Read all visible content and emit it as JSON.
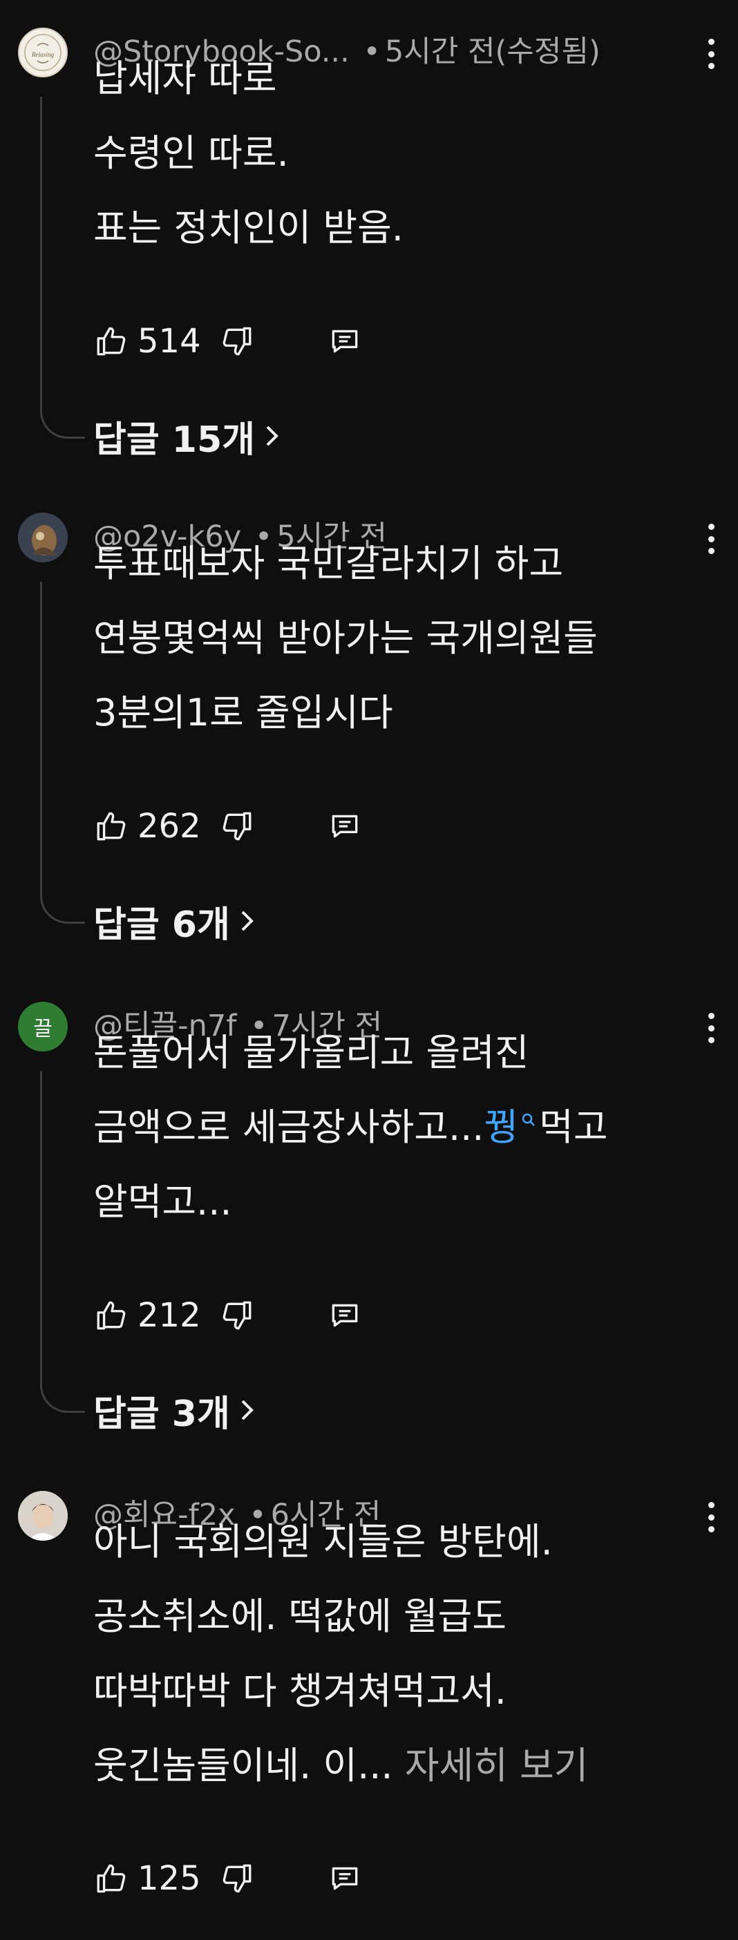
{
  "comments": [
    {
      "author": "@Storybook-So...",
      "time": "5시간 전(수정됨)",
      "avatar_text": "Relaxing",
      "lines": [
        "납세자 따로",
        "수령인 따로.",
        "표는 정치인이 받음."
      ],
      "likes": "514",
      "replies_label": "답글 15개"
    },
    {
      "author": "@o2v-k6y",
      "time": "5시간 전",
      "lines": [
        "투표때보자 국민갈라치기 하고",
        "연봉몇억씩 받아가는 국개의원들",
        "3분의1로 줄입시다"
      ],
      "likes": "262",
      "replies_label": "답글 6개"
    },
    {
      "author": "@티끌-n7f",
      "time": "7시간 전",
      "avatar_text": "끌",
      "lines": [
        "돈풀어서 물가올리고 올려진"
      ],
      "line2_prefix": "금액으로 세금장사하고...",
      "line2_link": "꿩",
      "line2_suffix": "먹고",
      "line3": "알먹고...",
      "likes": "212",
      "replies_label": "답글 3개"
    },
    {
      "author": "@회요-f2x",
      "time": "6시간 전",
      "lines": [
        "아니 국회의원 지들은 방탄에.",
        "공소취소에. 떡값에 월급도",
        "따박따박 다 챙겨쳐먹고서."
      ],
      "line4_prefix": "웃긴놈들이네. 이...",
      "more_label": "자세히 보기",
      "likes": "125"
    }
  ],
  "colors": {
    "background": "#0f0f0f",
    "text": "#f1f1f1",
    "secondary": "#aaaaaa",
    "link": "#3ea6ff",
    "avatar_green": "#2e7d32"
  }
}
